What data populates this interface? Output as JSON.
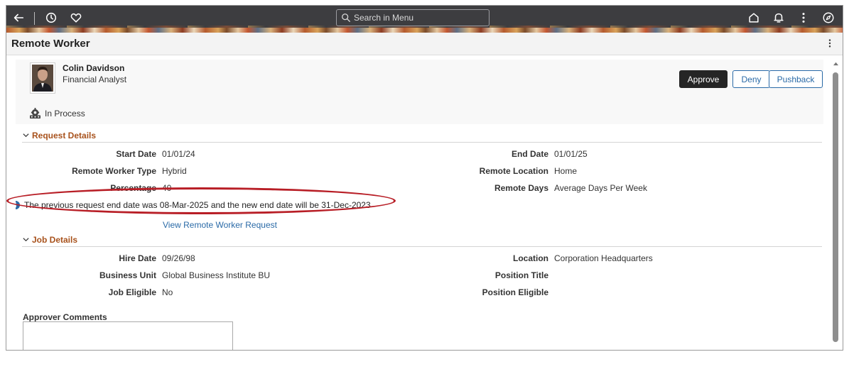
{
  "header": {
    "search_placeholder": "Search in Menu",
    "icons": [
      "back-arrow-icon",
      "history-icon",
      "favorite-heart-icon",
      "home-icon",
      "bell-icon",
      "more-vertical-icon",
      "compass-icon"
    ]
  },
  "page": {
    "title": "Remote Worker"
  },
  "employee": {
    "name": "Colin Davidson",
    "job_title": "Financial Analyst",
    "status": "In Process"
  },
  "actions": {
    "approve": "Approve",
    "deny": "Deny",
    "pushback": "Pushback"
  },
  "request_details": {
    "heading": "Request Details",
    "start_date_label": "Start Date",
    "start_date": "01/01/24",
    "end_date_label": "End Date",
    "end_date": "01/01/25",
    "type_label": "Remote Worker Type",
    "type": "Hybrid",
    "location_label": "Remote Location",
    "location": "Home",
    "percentage_label": "Percentage",
    "percentage": "40",
    "remote_days_label": "Remote Days",
    "remote_days": "Average Days Per Week",
    "info_message": "The previous request end date was 08-Mar-2025 and the new end date will be 31-Dec-2023",
    "view_link": "View Remote Worker Request"
  },
  "job_details": {
    "heading": "Job Details",
    "hire_date_label": "Hire Date",
    "hire_date": "09/26/98",
    "location_label": "Location",
    "location": "Corporation Headquarters",
    "business_unit_label": "Business Unit",
    "business_unit": "Global Business Institute BU",
    "position_title_label": "Position Title",
    "position_title": "",
    "job_eligible_label": "Job Eligible",
    "job_eligible": "No",
    "position_eligible_label": "Position Eligible",
    "position_eligible": ""
  },
  "comments": {
    "label": "Approver Comments",
    "value": ""
  },
  "colors": {
    "banner": "#3d3d40",
    "section_heading": "#a8521c",
    "link": "#2a6aa7",
    "primary_button": "#252525",
    "annotation": "#b81e26",
    "info": "#2a6aa7"
  }
}
